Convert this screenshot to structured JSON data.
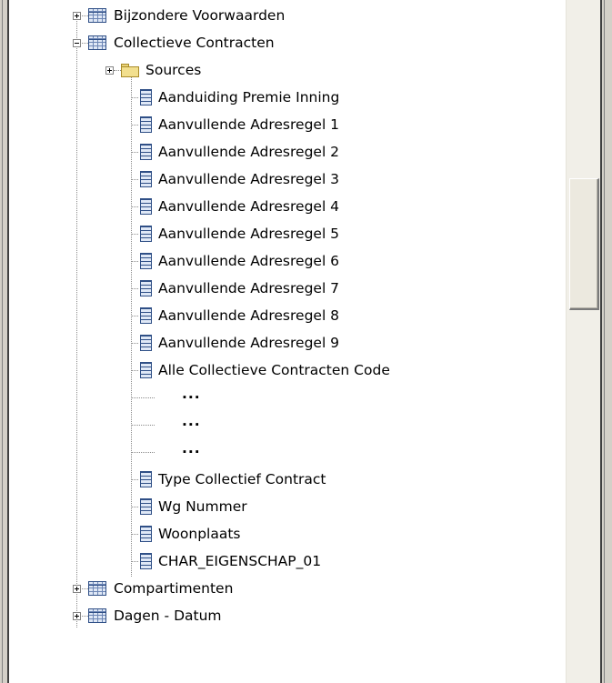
{
  "tree": {
    "nodes": [
      {
        "label": "Bijzondere Voorwaarden",
        "kind": "table",
        "expander": "plus",
        "level": 1
      },
      {
        "label": "Collectieve Contracten",
        "kind": "table",
        "expander": "minus",
        "level": 1
      },
      {
        "label": "Sources",
        "kind": "folder",
        "expander": "plus",
        "level": 2
      },
      {
        "label": "Aanduiding Premie Inning",
        "kind": "field",
        "level": 2
      },
      {
        "label": "Aanvullende Adresregel 1",
        "kind": "field",
        "level": 2
      },
      {
        "label": "Aanvullende Adresregel 2",
        "kind": "field",
        "level": 2
      },
      {
        "label": "Aanvullende Adresregel 3",
        "kind": "field",
        "level": 2
      },
      {
        "label": "Aanvullende Adresregel 4",
        "kind": "field",
        "level": 2
      },
      {
        "label": "Aanvullende Adresregel 5",
        "kind": "field",
        "level": 2
      },
      {
        "label": "Aanvullende Adresregel 6",
        "kind": "field",
        "level": 2
      },
      {
        "label": "Aanvullende Adresregel 7",
        "kind": "field",
        "level": 2
      },
      {
        "label": "Aanvullende Adresregel 8",
        "kind": "field",
        "level": 2
      },
      {
        "label": "Aanvullende Adresregel 9",
        "kind": "field",
        "level": 2
      },
      {
        "label": "Alle Collectieve Contracten Code",
        "kind": "field",
        "level": 2
      },
      {
        "label": "...",
        "kind": "ellipsis",
        "level": 2
      },
      {
        "label": "...",
        "kind": "ellipsis",
        "level": 2
      },
      {
        "label": "...",
        "kind": "ellipsis",
        "level": 2
      },
      {
        "label": "Type Collectief Contract",
        "kind": "field",
        "level": 2
      },
      {
        "label": "Wg Nummer",
        "kind": "field",
        "level": 2
      },
      {
        "label": "Woonplaats",
        "kind": "field",
        "level": 2
      },
      {
        "label": "CHAR_EIGENSCHAP_01",
        "kind": "field",
        "level": 2
      },
      {
        "label": "Compartimenten",
        "kind": "table",
        "expander": "plus",
        "level": 1
      },
      {
        "label": "Dagen - Datum",
        "kind": "table",
        "expander": "plus",
        "level": 1
      }
    ]
  },
  "colors": {
    "frame": "#d4d0c8",
    "scrollbar_track": "#f1efe8",
    "icon_blue": "#2f4f86",
    "folder_yellow": "#f2df8e"
  }
}
